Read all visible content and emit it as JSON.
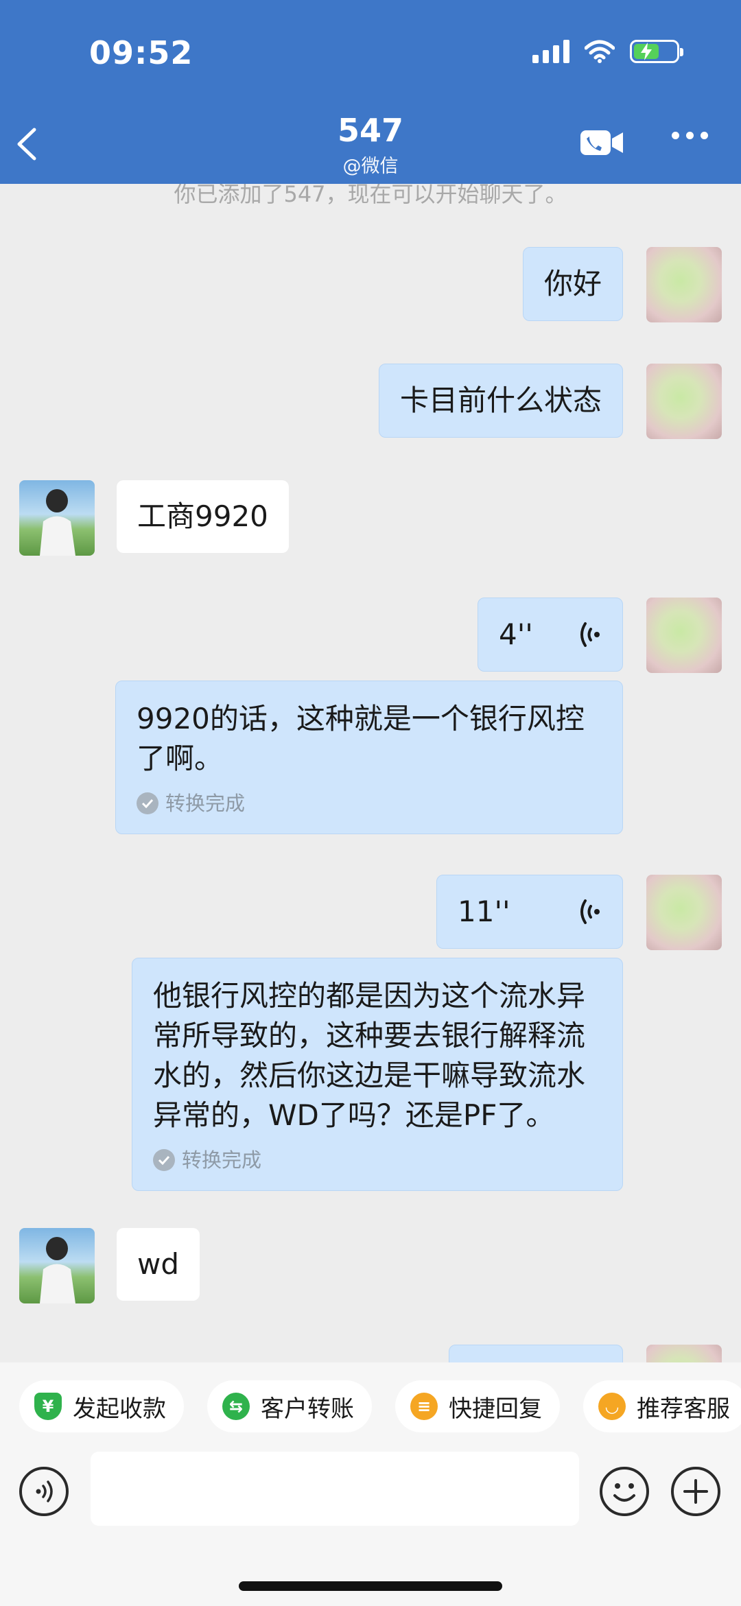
{
  "status": {
    "time": "09:52"
  },
  "header": {
    "title": "547",
    "subtitle": "@微信"
  },
  "chat": {
    "system_note": "你已添加了547，现在可以开始聊天了。",
    "messages": [
      {
        "from": "me",
        "type": "text",
        "text": "你好"
      },
      {
        "from": "me",
        "type": "text",
        "text": "卡目前什么状态"
      },
      {
        "from": "them",
        "type": "text",
        "text": "工商9920"
      },
      {
        "from": "me",
        "type": "voice",
        "duration": "4''",
        "transcript": "9920的话，这种就是一个银行风控了啊。",
        "status": "转换完成"
      },
      {
        "from": "me",
        "type": "voice",
        "duration": "11''",
        "transcript": "他银行风控的都是因为这个流水异常所导致的，这种要去银行解释流水的，然后你这边是干嘛导致流水异常的，WD了吗？还是PF了。",
        "status": "转换完成"
      },
      {
        "from": "them",
        "type": "text",
        "text": "wd"
      }
    ]
  },
  "quick_actions": [
    {
      "label": "发起收款",
      "icon": "yuan-shield-icon",
      "color": "#2fb24c"
    },
    {
      "label": "客户转账",
      "icon": "transfer-icon",
      "color": "#2fb24c"
    },
    {
      "label": "快捷回复",
      "icon": "quick-reply-icon",
      "color": "#f5a623"
    },
    {
      "label": "推荐客服",
      "icon": "recommend-icon",
      "color": "#f5a623"
    }
  ],
  "input": {
    "value": "",
    "placeholder": ""
  },
  "colors": {
    "header": "#3e77c8",
    "bubble_out": "#cfe5fc",
    "bubble_in": "#ffffff",
    "background": "#ededed"
  }
}
